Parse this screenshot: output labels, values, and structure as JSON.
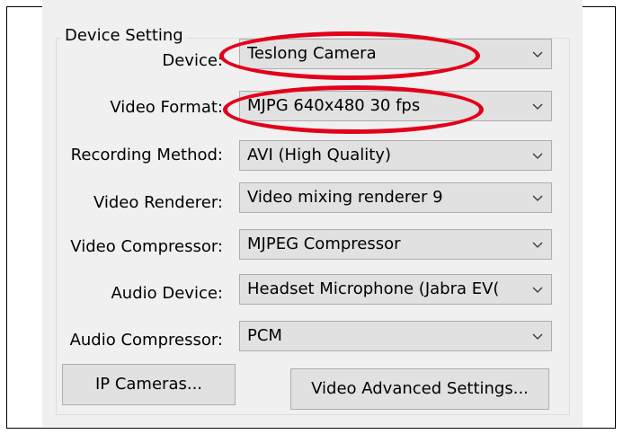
{
  "group": {
    "title": "Device Setting"
  },
  "rows": [
    {
      "label": "Device:",
      "value": "Teslong Camera"
    },
    {
      "label": "Video Format:",
      "value": "MJPG 640x480 30 fps"
    },
    {
      "label": "Recording Method:",
      "value": "AVI (High Quality)"
    },
    {
      "label": "Video Renderer:",
      "value": "Video mixing renderer 9"
    },
    {
      "label": "Video Compressor:",
      "value": "MJPEG Compressor"
    },
    {
      "label": "Audio Device:",
      "value": "Headset Microphone (Jabra EV("
    },
    {
      "label": "Audio Compressor:",
      "value": "PCM"
    }
  ],
  "buttons": {
    "ip_cameras": "IP Cameras...",
    "video_advanced": "Video Advanced Settings..."
  },
  "icons": {
    "dropdown": "chevron-down-icon"
  },
  "colors": {
    "annotation": "#e3001b",
    "panel": "#f0f0f0",
    "control": "#e1e1e1"
  }
}
